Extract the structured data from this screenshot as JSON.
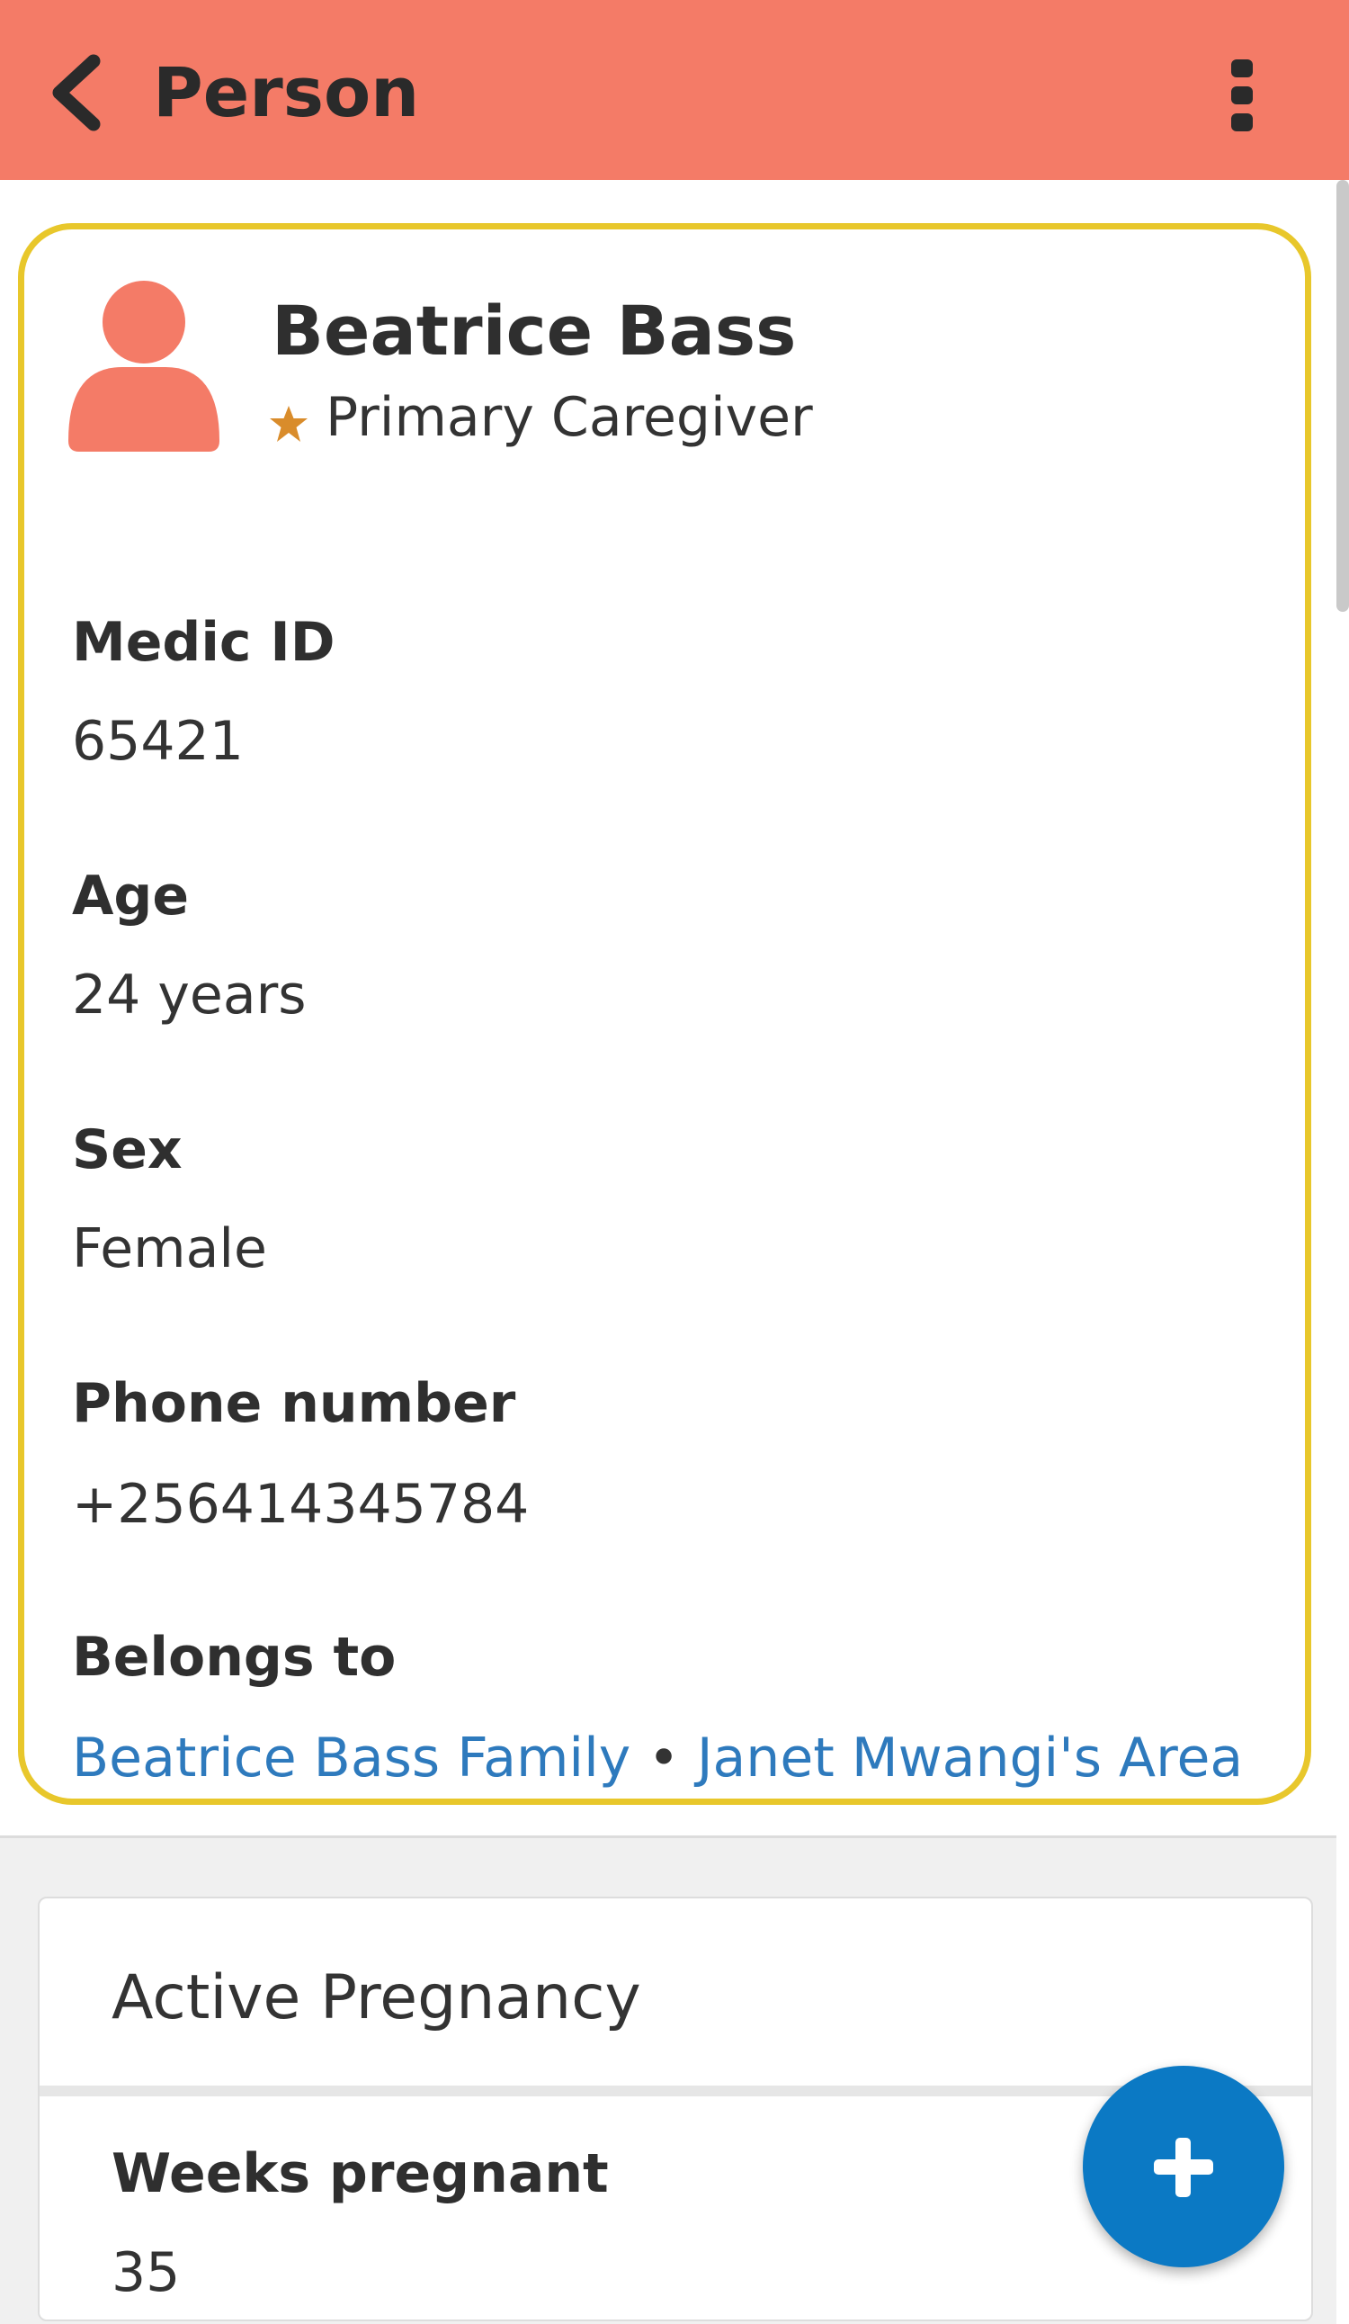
{
  "header": {
    "title": "Person",
    "back_icon": "chevron-left-icon",
    "menu_icon": "vertical-dots-icon",
    "background_color": "#F47B67"
  },
  "person": {
    "name": "Beatrice Bass",
    "role": "Primary Caregiver",
    "avatar_icon": "person-icon",
    "role_icon": "star-icon",
    "highlight_color": "#E8C72B"
  },
  "fields": [
    {
      "label": "Medic ID",
      "value": "65421"
    },
    {
      "label": "Age",
      "value": "24 years"
    },
    {
      "label": "Sex",
      "value": "Female"
    },
    {
      "label": "Phone number",
      "value": "+256414345784"
    }
  ],
  "belongs_to": {
    "label": "Belongs to",
    "family_link": "Beatrice Bass Family",
    "separator": "•",
    "area_link": "Janet Mwangi's Area",
    "link_color": "#2E7ABD"
  },
  "pregnancy": {
    "header": "Active Pregnancy",
    "weeks_label": "Weeks pregnant",
    "weeks_value": "35"
  },
  "fab": {
    "icon": "plus-icon",
    "color": "#0B79C4"
  }
}
